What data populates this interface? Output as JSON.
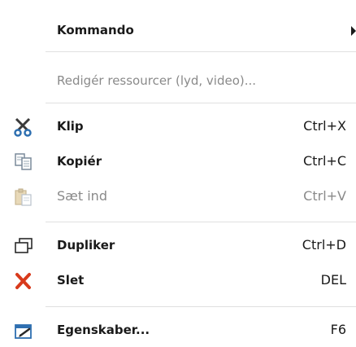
{
  "menu": {
    "items": [
      {
        "label": "Kommando",
        "shortcut": "",
        "icon": "",
        "submenu": true,
        "disabled": false
      },
      {
        "label": "Redigér ressourcer (lyd, video)...",
        "shortcut": "",
        "icon": "",
        "submenu": false,
        "disabled": true
      },
      {
        "label": "Klip",
        "shortcut": "Ctrl+X",
        "icon": "scissors-icon",
        "submenu": false,
        "disabled": false
      },
      {
        "label": "Kopiér",
        "shortcut": "Ctrl+C",
        "icon": "copy-icon",
        "submenu": false,
        "disabled": false
      },
      {
        "label": "Sæt ind",
        "shortcut": "Ctrl+V",
        "icon": "paste-icon",
        "submenu": false,
        "disabled": true
      },
      {
        "label": "Dupliker",
        "shortcut": "Ctrl+D",
        "icon": "duplicate-icon",
        "submenu": false,
        "disabled": false
      },
      {
        "label": "Slet",
        "shortcut": "DEL",
        "icon": "delete-icon",
        "submenu": false,
        "disabled": false
      },
      {
        "label": "Egenskaber...",
        "shortcut": "F6",
        "icon": "properties-icon",
        "submenu": false,
        "disabled": false
      }
    ]
  },
  "colors": {
    "text": "#1a1a1a",
    "disabled_text": "#8a8a8a",
    "separator": "#e0e0e0",
    "delete_red": "#d83a1c",
    "icon_blue": "#2e6fb0"
  }
}
